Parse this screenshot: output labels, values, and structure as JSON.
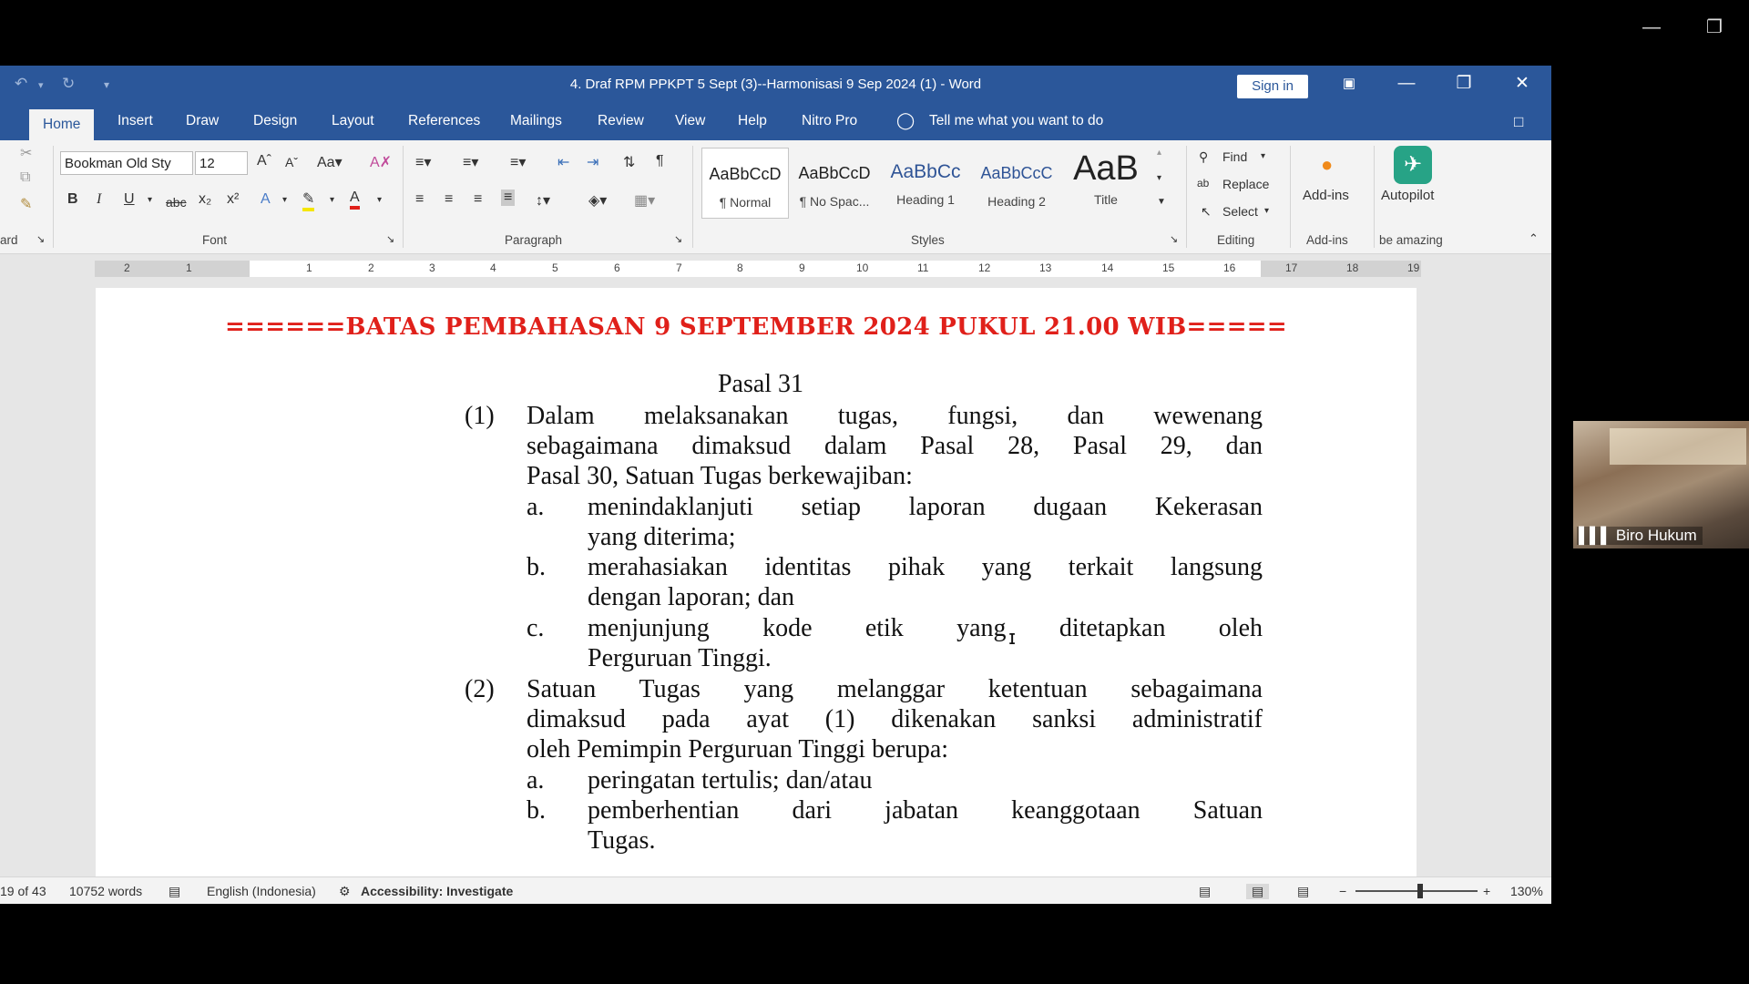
{
  "app": {
    "title": "4. Draf RPM PPKPT 5 Sept (3)--Harmonisasi 9 Sep 2024 (1)  -  Word",
    "sign_in": "Sign in"
  },
  "tabs": [
    "Home",
    "Insert",
    "Draw",
    "Design",
    "Layout",
    "References",
    "Mailings",
    "Review",
    "View",
    "Help",
    "Nitro Pro"
  ],
  "tell_me": "Tell me what you want to do",
  "ribbon": {
    "font_name": "Bookman Old Sty",
    "font_size": "12",
    "groups": {
      "clipboard": "ard",
      "font": "Font",
      "paragraph": "Paragraph",
      "styles": "Styles",
      "editing": "Editing",
      "addins": "Add-ins",
      "autopilot": "be amazing"
    },
    "styles": [
      {
        "preview": "AaBbCcD",
        "name": "¶ Normal"
      },
      {
        "preview": "AaBbCcD",
        "name": "¶ No Spac..."
      },
      {
        "preview": "AaBbCc",
        "name": "Heading 1"
      },
      {
        "preview": "AaBbCcC",
        "name": "Heading 2"
      },
      {
        "preview": "AaB",
        "name": "Title"
      }
    ],
    "editing": {
      "find": "Find",
      "replace": "Replace",
      "select": "Select"
    },
    "addins_label": "Add-ins",
    "autopilot_label": "Autopilot"
  },
  "ruler": [
    "2",
    "1",
    "1",
    "2",
    "3",
    "4",
    "5",
    "6",
    "7",
    "8",
    "9",
    "10",
    "11",
    "12",
    "13",
    "14",
    "15",
    "16",
    "17",
    "18",
    "19"
  ],
  "document": {
    "banner": "======BATAS PEMBAHASAN 9 SEPTEMBER 2024 PUKUL 21.00 WIB=====",
    "heading": "Pasal 31",
    "para1_num": "(1)",
    "para1_lines": [
      "Dalam melaksanakan tugas, fungsi, dan wewenang",
      "sebagaimana dimaksud dalam Pasal 28, Pasal 29, dan",
      "Pasal 30, Satuan Tugas berkewajiban:"
    ],
    "items1": [
      {
        "letter": "a.",
        "lines": [
          "menindaklanjuti setiap laporan dugaan Kekerasan",
          "yang diterima;"
        ]
      },
      {
        "letter": "b.",
        "lines": [
          "merahasiakan identitas pihak yang terkait langsung",
          "dengan laporan; dan"
        ]
      },
      {
        "letter": "c.",
        "lines": [
          "menjunjung kode etik yang ditetapkan oleh",
          "Perguruan Tinggi."
        ]
      }
    ],
    "para2_num": "(2)",
    "para2_lines": [
      "Satuan Tugas yang melanggar ketentuan sebagaimana",
      "dimaksud pada ayat (1) dikenakan sanksi administratif",
      "oleh Pemimpin Perguruan Tinggi berupa:"
    ],
    "items2": [
      {
        "letter": "a.",
        "lines": [
          "peringatan tertulis; dan/atau"
        ]
      },
      {
        "letter": "b.",
        "lines": [
          "pemberhentian dari jabatan keanggotaan Satuan",
          "Tugas."
        ]
      }
    ]
  },
  "status": {
    "page": "19 of 43",
    "words": "10752 words",
    "language": "English (Indonesia)",
    "accessibility": "Accessibility: Investigate",
    "zoom": "130%"
  },
  "video": {
    "name": "Biro Hukum"
  }
}
